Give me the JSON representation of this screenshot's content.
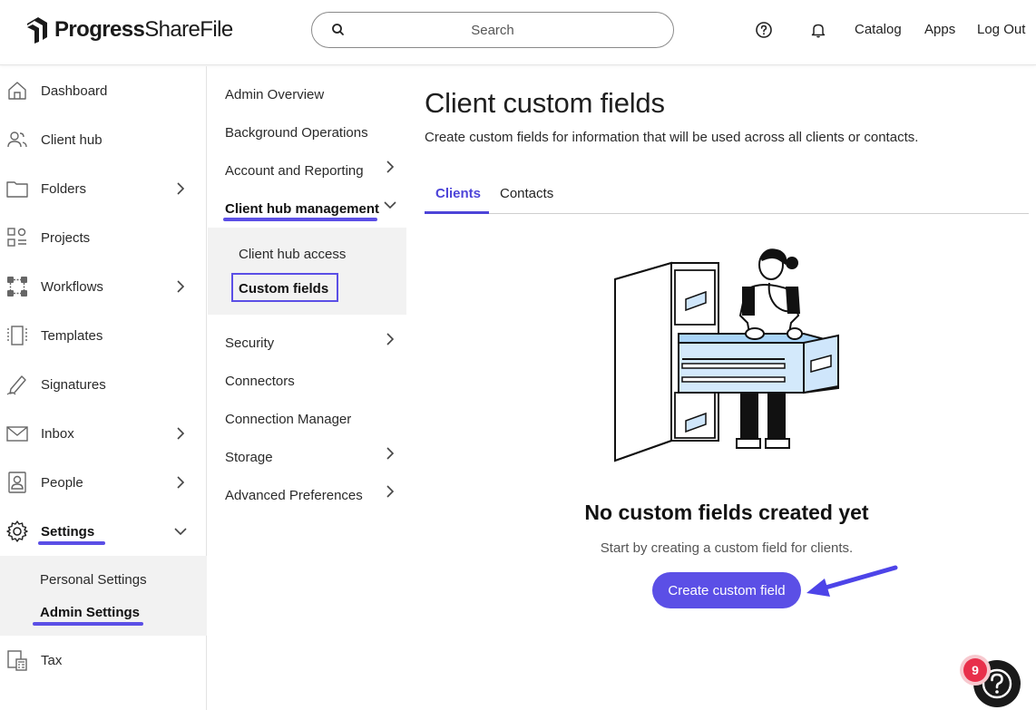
{
  "header": {
    "logo_word1": "Progress",
    "logo_word2": "ShareFile",
    "search_placeholder": "Search",
    "links": [
      "Catalog",
      "Apps",
      "Log Out"
    ]
  },
  "leftnav": {
    "items": [
      {
        "label": "Dashboard",
        "icon": "home-icon"
      },
      {
        "label": "Client hub",
        "icon": "users-icon"
      },
      {
        "label": "Folders",
        "icon": "folder-icon",
        "chevron": "right"
      },
      {
        "label": "Projects",
        "icon": "projects-icon"
      },
      {
        "label": "Workflows",
        "icon": "workflow-icon",
        "chevron": "right"
      },
      {
        "label": "Templates",
        "icon": "template-icon"
      },
      {
        "label": "Signatures",
        "icon": "signature-icon"
      },
      {
        "label": "Inbox",
        "icon": "mail-icon",
        "chevron": "right"
      },
      {
        "label": "People",
        "icon": "person-icon",
        "chevron": "right"
      },
      {
        "label": "Settings",
        "icon": "gear-icon",
        "chevron": "down"
      },
      {
        "label": "Tax",
        "icon": "tax-icon"
      }
    ],
    "settings_sub": [
      "Personal Settings",
      "Admin Settings"
    ]
  },
  "midnav": {
    "items": [
      "Admin Overview",
      "Background Operations",
      "Account and Reporting",
      "Client hub management",
      "Security",
      "Connectors",
      "Connection Manager",
      "Storage",
      "Advanced Preferences"
    ],
    "sub": [
      "Client hub access",
      "Custom fields"
    ]
  },
  "main": {
    "title": "Client custom fields",
    "description": "Create custom fields for information that will be used across all clients or contacts.",
    "tabs": [
      "Clients",
      "Contacts"
    ],
    "empty_title": "No custom fields created yet",
    "empty_subtitle": "Start by creating a custom field for clients.",
    "create_button": "Create custom field"
  },
  "help": {
    "badge_count": "9"
  },
  "colors": {
    "accent": "#5b4fe6",
    "badge": "#e8304b"
  }
}
